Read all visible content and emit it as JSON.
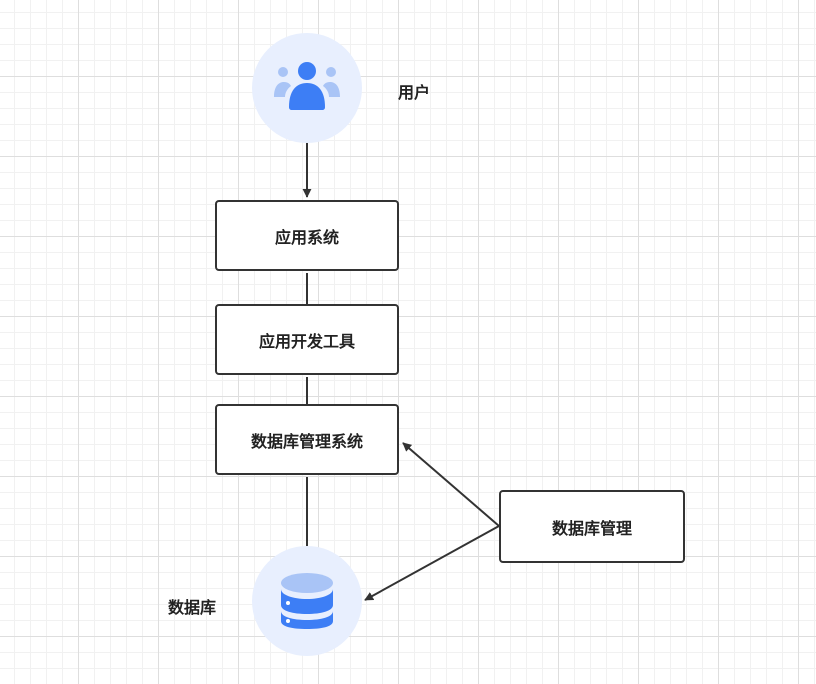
{
  "nodes": {
    "user": {
      "label": "用户",
      "icon": "users-icon"
    },
    "app_system": {
      "label": "应用系统"
    },
    "dev_tools": {
      "label": "应用开发工具"
    },
    "dbms": {
      "label": "数据库管理系统"
    },
    "db_admin": {
      "label": "数据库管理"
    },
    "database": {
      "label": "数据库",
      "icon": "database-icon"
    }
  },
  "colors": {
    "icon_blue": "#3d7ef5",
    "icon_light_blue": "#a9c4f6",
    "circle_fill": "#e8effe",
    "stroke": "#333333"
  }
}
